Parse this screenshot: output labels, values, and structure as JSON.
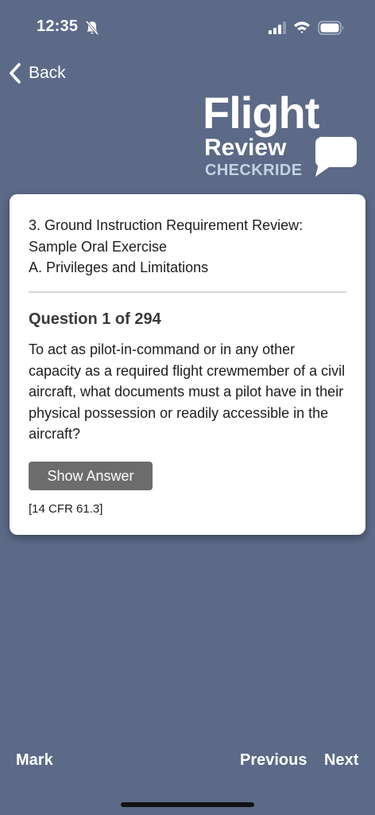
{
  "status_bar": {
    "time": "12:35",
    "icons": [
      "bell-slash-icon",
      "signal-bars-icon",
      "wifi-icon",
      "battery-icon"
    ]
  },
  "nav": {
    "back_label": "Back"
  },
  "logo": {
    "line1": "Flight",
    "line2": "Review",
    "line3": "CHECKRIDE"
  },
  "card": {
    "section_lines": [
      "3. Ground Instruction Requirement Review:",
      "Sample Oral Exercise",
      "A. Privileges and Limitations"
    ],
    "question_count": "Question 1 of 294",
    "question_text": "To act as pilot-in-command or in any other capacity as a required flight crewmember of a civil aircraft, what documents must a pilot have in their physical possession or readily accessible in the aircraft?",
    "show_answer_label": "Show Answer",
    "reference": "[14 CFR 61.3]"
  },
  "bottom_nav": {
    "mark_label": "Mark",
    "previous_label": "Previous",
    "next_label": "Next"
  },
  "colors": {
    "background": "#5c6a87",
    "card": "#ffffff",
    "button": "#6c6c6c",
    "logo_accent": "#c6d0e3"
  }
}
